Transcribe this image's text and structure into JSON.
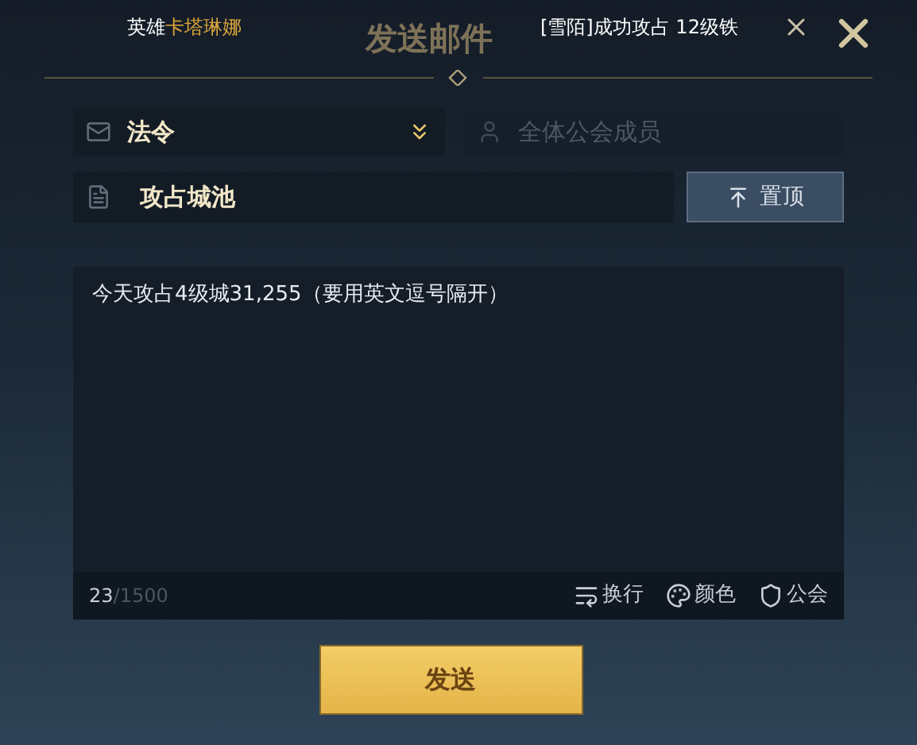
{
  "ticker": {
    "hero_label": "英雄",
    "hero_name": "卡塔琳娜",
    "message": "[雪陌]成功攻占 12级铁"
  },
  "title": "发送邮件",
  "mail_type": {
    "value": "法令"
  },
  "recipient": {
    "placeholder": "全体公会成员"
  },
  "subject": {
    "value": "攻占城池"
  },
  "pin_button": "置顶",
  "body": {
    "value": "今天攻占4级城31,255（要用英文逗号隔开）"
  },
  "counter": {
    "count": "23",
    "limit": "/1500"
  },
  "tools": [
    {
      "kind": "line-break",
      "label": "换行"
    },
    {
      "kind": "color",
      "label": "颜色"
    },
    {
      "kind": "guild",
      "label": "公会"
    }
  ],
  "send_button": "发送"
}
